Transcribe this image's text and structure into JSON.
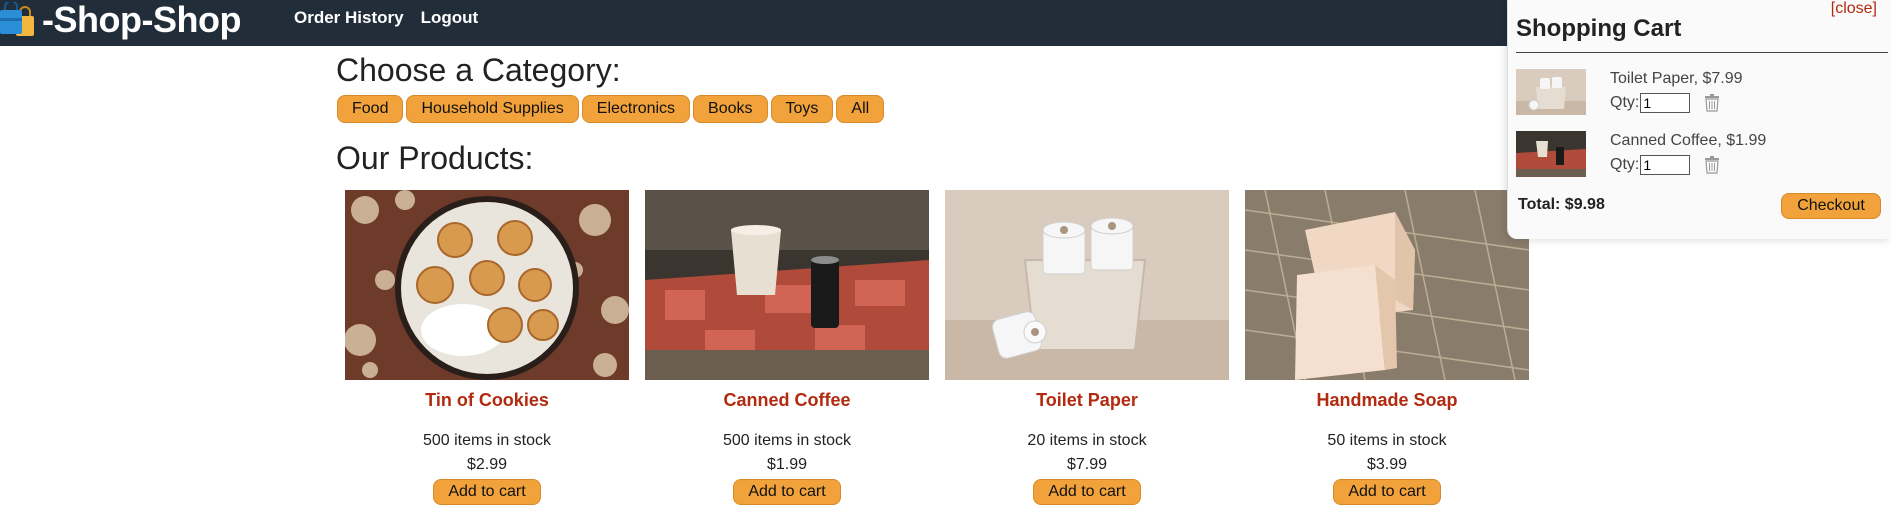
{
  "header": {
    "title": "-Shop-Shop",
    "nav": [
      "Order History",
      "Logout"
    ],
    "logo_icon": "shopping-bags-icon"
  },
  "categories_section": {
    "title": "Choose a Category:",
    "buttons": [
      "Food",
      "Household Supplies",
      "Electronics",
      "Books",
      "Toys",
      "All"
    ]
  },
  "products_section": {
    "title": "Our Products:",
    "products": [
      {
        "name": "Tin of Cookies",
        "stock": "500 items in stock",
        "price": "$2.99",
        "button": "Add to cart"
      },
      {
        "name": "Canned Coffee",
        "stock": "500 items in stock",
        "price": "$1.99",
        "button": "Add to cart"
      },
      {
        "name": "Toilet Paper",
        "stock": "20 items in stock",
        "price": "$7.99",
        "button": "Add to cart"
      },
      {
        "name": "Handmade Soap",
        "stock": "50 items in stock",
        "price": "$3.99",
        "button": "Add to cart"
      }
    ]
  },
  "cart": {
    "close_label": "[close]",
    "title": "Shopping Cart",
    "qty_label": "Qty:",
    "items": [
      {
        "label": "Toilet Paper, $7.99",
        "qty": "1"
      },
      {
        "label": "Canned Coffee, $1.99",
        "qty": "1"
      }
    ],
    "total": "Total: $9.98",
    "checkout_label": "Checkout"
  },
  "colors": {
    "header_bg": "#222d3a",
    "accent": "#f2a23a",
    "product_name": "#b22a10"
  }
}
